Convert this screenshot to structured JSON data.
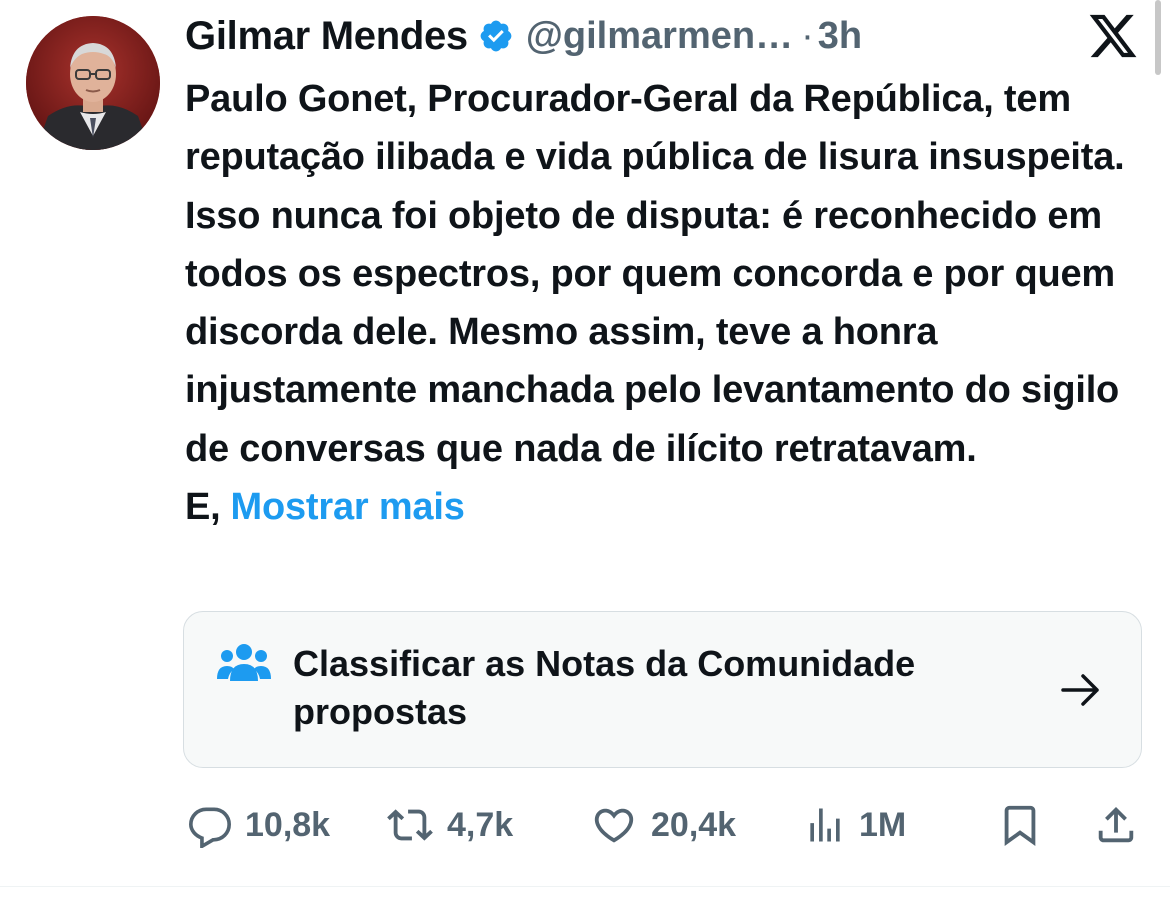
{
  "author": {
    "name": "Gilmar Mendes",
    "handle": "@gilmarmen…",
    "separator": "·",
    "time": "3h",
    "verified": true,
    "verified_color": "#1d9bf0"
  },
  "tweet": {
    "text": "Paulo Gonet, Procurador-Geral da República, tem reputação ilibada e vida pública de lisura insuspeita. Isso nunca foi objeto de disputa: é reconhecido em todos os espectros, por quem concorda e por quem discorda dele. Mesmo assim, teve a honra injustamente manchada pelo levantamento do sigilo de conversas que nada de ilícito retratavam. E,",
    "show_more": "Mostrar mais",
    "link_color": "#1d9bf0"
  },
  "community_notes": {
    "icon": "community-people-icon",
    "label": "Classificar as Notas da Comunidade propostas",
    "arrow_icon": "arrow-right-icon"
  },
  "actions": {
    "reply": {
      "icon": "reply-icon",
      "count": "10,8k"
    },
    "retweet": {
      "icon": "retweet-icon",
      "count": "4,7k"
    },
    "like": {
      "icon": "heart-icon",
      "count": "20,4k"
    },
    "views": {
      "icon": "views-icon",
      "count": "1M"
    },
    "bookmark": {
      "icon": "bookmark-icon"
    },
    "share": {
      "icon": "share-icon"
    }
  },
  "brand": {
    "logo": "x-logo-icon"
  },
  "colors": {
    "text": "#0f1419",
    "secondary": "#536471",
    "accent": "#1d9bf0",
    "card_bg": "#f7f9f9",
    "card_border": "#d7dee2"
  }
}
